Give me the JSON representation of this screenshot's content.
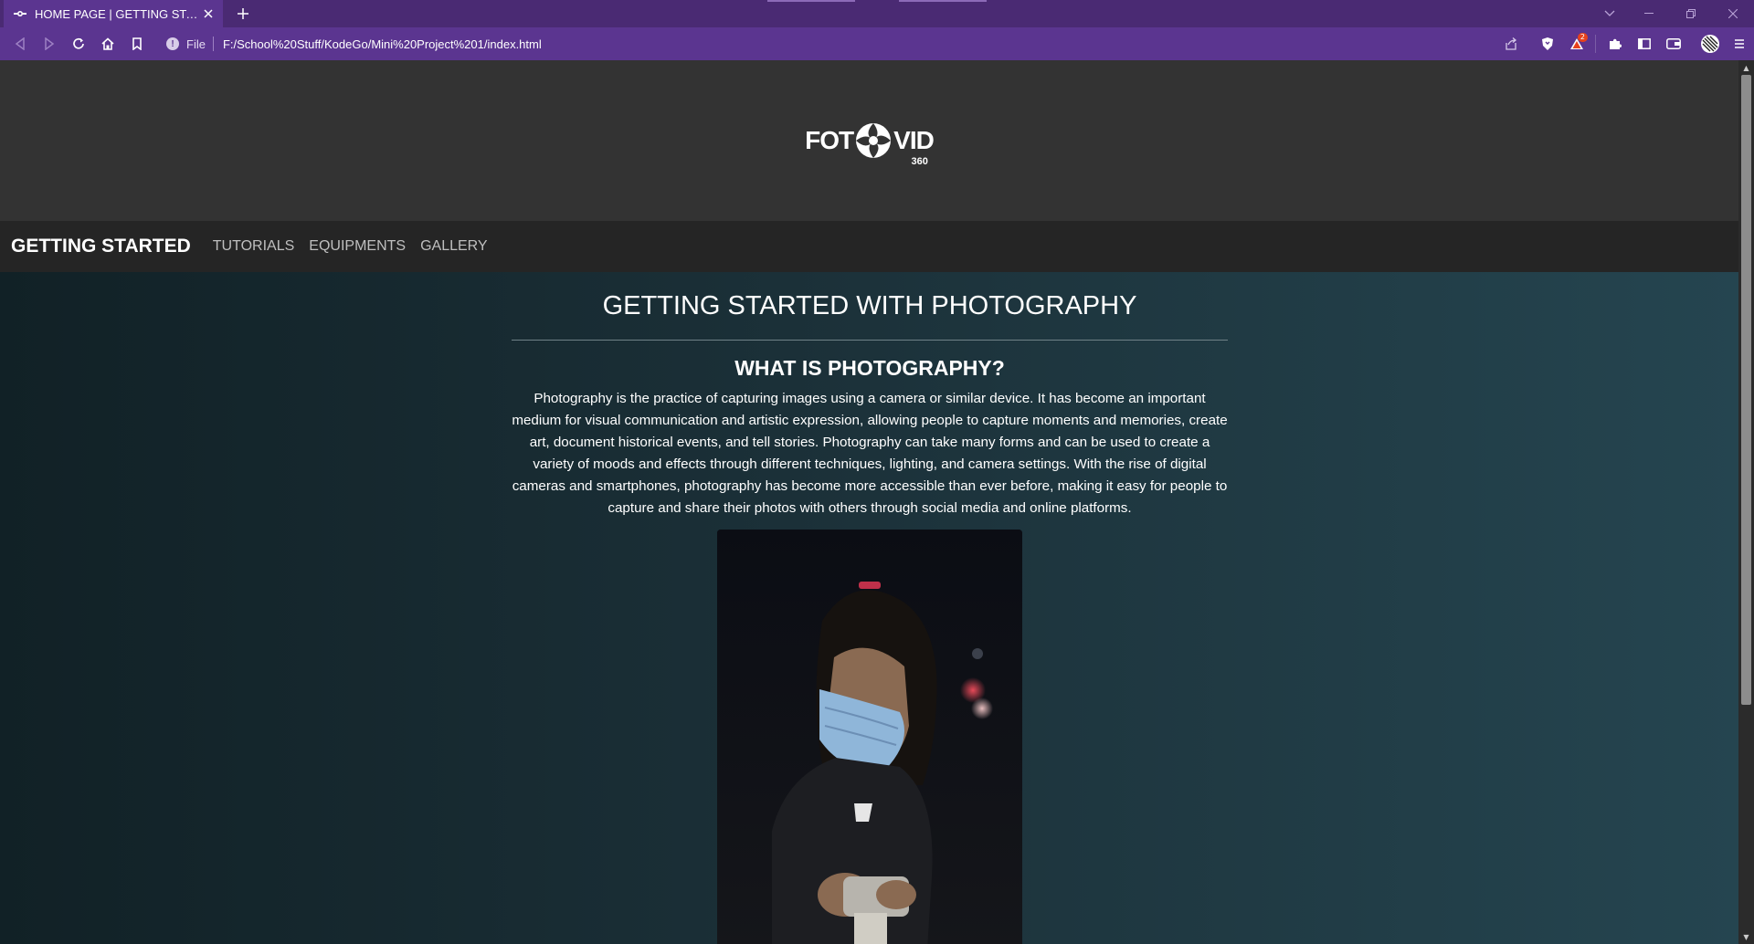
{
  "browser": {
    "tab_title": "HOME PAGE | GETTING STARTED",
    "url_scheme_label": "File",
    "url": "F:/School%20Stuff/KodeGo/Mini%20Project%201/index.html",
    "notification_count": "2",
    "accent_color": "#5b3590"
  },
  "site": {
    "logo_text_left": "FOT",
    "logo_text_right": "VID",
    "logo_subtext": "360",
    "nav": {
      "active": "GETTING STARTED",
      "links": [
        "TUTORIALS",
        "EQUIPMENTS",
        "GALLERY"
      ]
    },
    "page_title": "GETTING STARTED WITH PHOTOGRAPHY",
    "section": {
      "heading": "WHAT IS PHOTOGRAPHY?",
      "text": "Photography is the practice of capturing images using a camera or similar device. It has become an important medium for visual communication and artistic expression, allowing people to capture moments and memories, create art, document historical events, and tell stories. Photography can take many forms and can be used to create a variety of moods and effects through different techniques, lighting, and camera settings. With the rise of digital cameras and smartphones, photography has become more accessible than ever before, making it easy for people to capture and share their photos with others through social media and online platforms."
    },
    "photo_subject": "person-with-face-mask-holding-camera"
  }
}
